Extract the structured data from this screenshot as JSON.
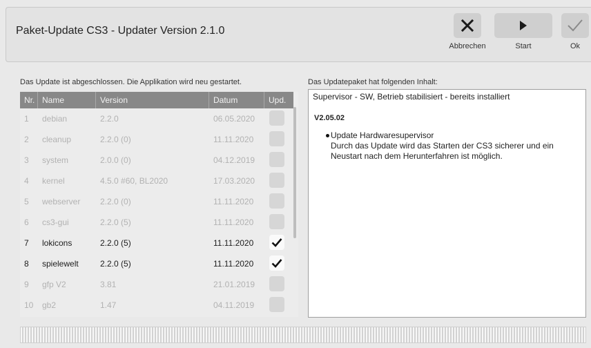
{
  "window": {
    "title": "Paket-Update CS3 - Updater Version 2.1.0"
  },
  "toolbar": {
    "cancel_label": "Abbrechen",
    "start_label": "Start",
    "ok_label": "Ok"
  },
  "left_panel": {
    "status": "Das Update ist abgeschlossen. Die Applikation wird neu gestartet.",
    "columns": [
      "Nr.",
      "Name",
      "Version",
      "Datum",
      "Upd."
    ],
    "rows": [
      {
        "nr": "1",
        "name": "debian",
        "version": "2.2.0",
        "date": "06.05.2020",
        "checked": false
      },
      {
        "nr": "2",
        "name": "cleanup",
        "version": "2.2.0 (0)",
        "date": "11.11.2020",
        "checked": false
      },
      {
        "nr": "3",
        "name": "system",
        "version": "2.0.0 (0)",
        "date": "04.12.2019",
        "checked": false
      },
      {
        "nr": "4",
        "name": "kernel",
        "version": "4.5.0 #60, BL2020",
        "date": "17.03.2020",
        "checked": false
      },
      {
        "nr": "5",
        "name": "webserver",
        "version": "2.2.0 (0)",
        "date": "11.11.2020",
        "checked": false
      },
      {
        "nr": "6",
        "name": "cs3-gui",
        "version": "2.2.0 (5)",
        "date": "11.11.2020",
        "checked": false
      },
      {
        "nr": "7",
        "name": "lokicons",
        "version": "2.2.0 (5)",
        "date": "11.11.2020",
        "checked": true
      },
      {
        "nr": "8",
        "name": "spielewelt",
        "version": "2.2.0 (5)",
        "date": "11.11.2020",
        "checked": true
      },
      {
        "nr": "9",
        "name": "gfp V2",
        "version": "3.81",
        "date": "21.01.2019",
        "checked": false
      },
      {
        "nr": "10",
        "name": "gb2",
        "version": "1.47",
        "date": "04.11.2019",
        "checked": false
      }
    ]
  },
  "right_panel": {
    "heading": "Das Updatepaket hat folgenden Inhalt:",
    "summary": "Supervisor - SW, Betrieb stabilisiert - bereits installiert",
    "version": "V2.05.02",
    "bullet_title": "Update Hardwaresupervisor",
    "bullet_text": "Durch das Update wird das Starten der CS3 sicherer und ein Neustart nach dem Herunterfahren ist möglich."
  },
  "colors": {
    "header_bg": "#e3e3e3",
    "table_header_bg": "#888888",
    "button_bg": "#cfcfcf"
  }
}
